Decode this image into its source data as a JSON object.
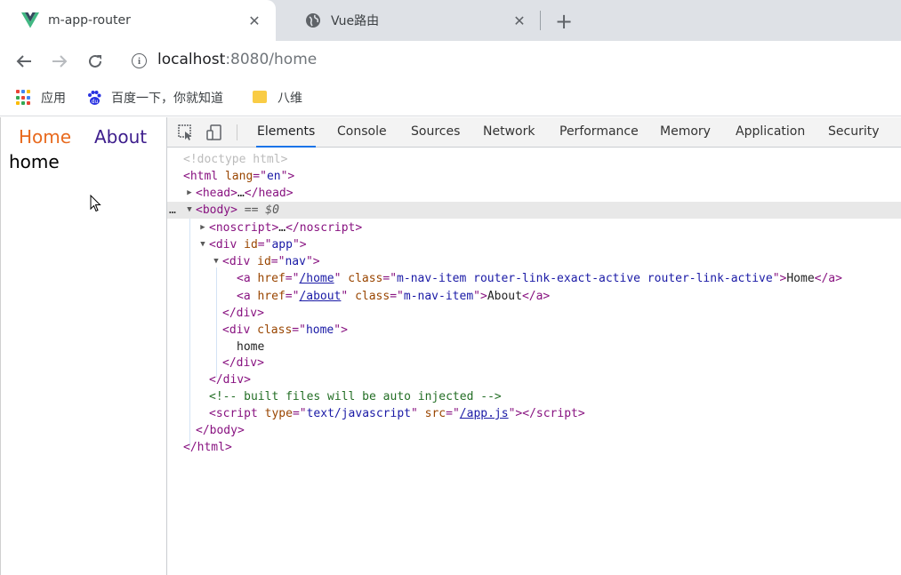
{
  "tabs": [
    {
      "title": "m-app-router",
      "icon": "vue-logo-icon",
      "active": true
    },
    {
      "title": "Vue路由",
      "icon": "globe-icon",
      "active": false
    }
  ],
  "new_tab_label": "+",
  "close_label": "✕",
  "address": {
    "host": "localhost",
    "rest": ":8080/home"
  },
  "bookmarks": [
    {
      "label": "应用",
      "icon": "apps-grid-icon"
    },
    {
      "label": "百度一下，你就知道",
      "icon": "baidu-paw-icon"
    },
    {
      "label": "八维",
      "icon": "folder-icon"
    }
  ],
  "page": {
    "nav_home": "Home",
    "nav_about": "About",
    "content": "home",
    "colors": {
      "active_link": "#e86a1e",
      "link": "#3d1d8c"
    }
  },
  "devtools": {
    "tabs": [
      "Elements",
      "Console",
      "Sources",
      "Network",
      "Performance",
      "Memory",
      "Application",
      "Security"
    ],
    "active_tab": "Elements",
    "dom": {
      "doctype": "<!doctype html>",
      "html_lang": "en",
      "body_marker": "== $0",
      "nav_home_href": "/home",
      "nav_home_class": "m-nav-item router-link-exact-active router-link-active",
      "nav_home_text": "Home",
      "nav_about_href": "/about",
      "nav_about_class": "m-nav-item",
      "nav_about_text": "About",
      "home_class": "home",
      "home_text": "home",
      "app_id": "app",
      "nav_id": "nav",
      "comment": "<!-- built files will be auto injected -->",
      "script_type": "text/javascript",
      "script_src": "/app.js"
    }
  }
}
